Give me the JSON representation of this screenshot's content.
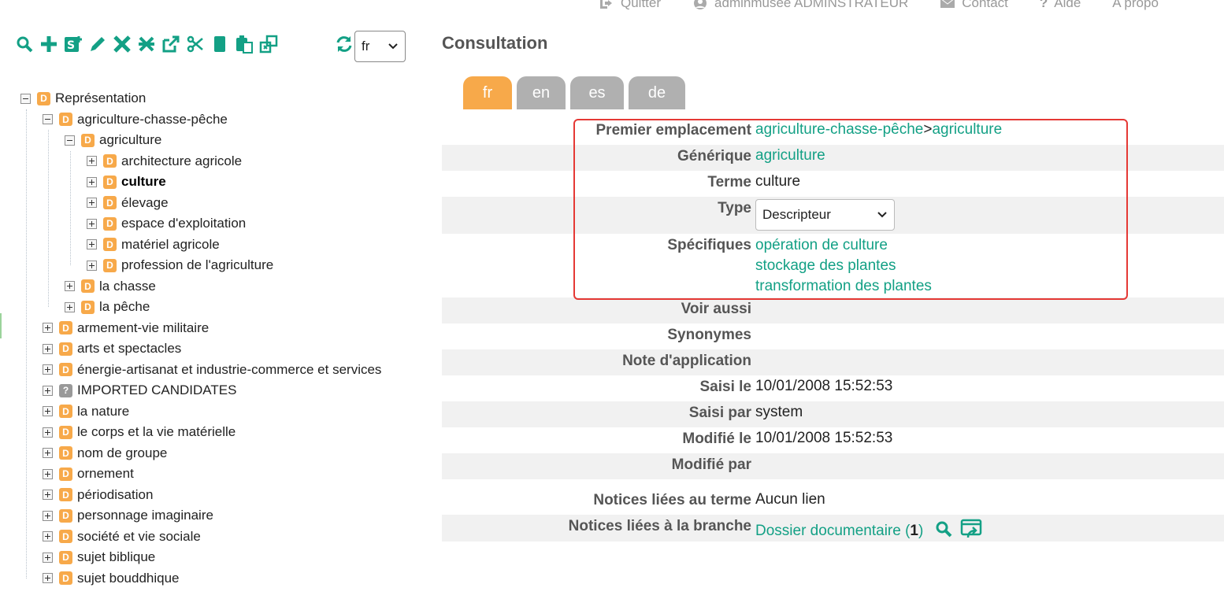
{
  "topnav": {
    "quit": "Quitter",
    "user": "adminmusee ADMINSTRATEUR",
    "contact": "Contact",
    "help": "Aide",
    "about": "A propo"
  },
  "toolbar": {
    "icons": [
      "search-icon",
      "add-icon",
      "add-sibling-icon",
      "edit-icon",
      "delete-icon",
      "move-icon",
      "external-link-icon",
      "cut-icon",
      "copy-icon",
      "paste-icon",
      "fusion-icon"
    ],
    "lang_value": "fr"
  },
  "tree": [
    {
      "label": "Représentation",
      "level": 0,
      "toggle": "minus",
      "badge": "D"
    },
    {
      "label": "agriculture-chasse-pêche",
      "level": 1,
      "toggle": "minus",
      "badge": "D"
    },
    {
      "label": "agriculture",
      "level": 2,
      "toggle": "minus",
      "badge": "D"
    },
    {
      "label": "architecture agricole",
      "level": 3,
      "toggle": "plus",
      "badge": "D"
    },
    {
      "label": "culture",
      "level": 3,
      "toggle": "plus",
      "badge": "D",
      "selected": true
    },
    {
      "label": "élevage",
      "level": 3,
      "toggle": "plus",
      "badge": "D"
    },
    {
      "label": "espace d'exploitation",
      "level": 3,
      "toggle": "plus",
      "badge": "D"
    },
    {
      "label": "matériel agricole",
      "level": 3,
      "toggle": "plus",
      "badge": "D"
    },
    {
      "label": "profession de l'agriculture",
      "level": 3,
      "toggle": "plus",
      "badge": "D"
    },
    {
      "label": "la chasse",
      "level": 2,
      "toggle": "plus",
      "badge": "D"
    },
    {
      "label": "la pêche",
      "level": 2,
      "toggle": "plus",
      "badge": "D"
    },
    {
      "label": "armement-vie militaire",
      "level": 1,
      "toggle": "plus",
      "badge": "D"
    },
    {
      "label": "arts et spectacles",
      "level": 1,
      "toggle": "plus",
      "badge": "D"
    },
    {
      "label": "énergie-artisanat et industrie-commerce et services",
      "level": 1,
      "toggle": "plus",
      "badge": "D"
    },
    {
      "label": "IMPORTED CANDIDATES",
      "level": 1,
      "toggle": "plus",
      "badge": "?"
    },
    {
      "label": "la nature",
      "level": 1,
      "toggle": "plus",
      "badge": "D"
    },
    {
      "label": "le corps et la vie matérielle",
      "level": 1,
      "toggle": "plus",
      "badge": "D"
    },
    {
      "label": "nom de groupe",
      "level": 1,
      "toggle": "plus",
      "badge": "D"
    },
    {
      "label": "ornement",
      "level": 1,
      "toggle": "plus",
      "badge": "D"
    },
    {
      "label": "périodisation",
      "level": 1,
      "toggle": "plus",
      "badge": "D"
    },
    {
      "label": "personnage imaginaire",
      "level": 1,
      "toggle": "plus",
      "badge": "D"
    },
    {
      "label": "société et vie sociale",
      "level": 1,
      "toggle": "plus",
      "badge": "D"
    },
    {
      "label": "sujet biblique",
      "level": 1,
      "toggle": "plus",
      "badge": "D"
    },
    {
      "label": "sujet bouddhique",
      "level": 1,
      "toggle": "plus",
      "badge": "D"
    }
  ],
  "consultation": {
    "title": "Consultation",
    "tabs": [
      "fr",
      "en",
      "es",
      "de"
    ],
    "active_tab": "fr",
    "premier_label": "Premier emplacement",
    "premier_parent": "agriculture-chasse-pêche",
    "premier_sep": ">",
    "premier_child": "agriculture",
    "generique_label": "Générique",
    "generique_value": "agriculture",
    "terme_label": "Terme",
    "terme_value": "culture",
    "type_label": "Type",
    "type_value": "Descripteur",
    "specifiques_label": "Spécifiques",
    "specifiques": [
      "opération de culture",
      "stockage des plantes",
      "transformation des plantes"
    ],
    "voir_label": "Voir aussi",
    "synonymes_label": "Synonymes",
    "note_label": "Note d'application",
    "saisi_le_label": "Saisi le",
    "saisi_le_value": "10/01/2008 15:52:53",
    "saisi_par_label": "Saisi par",
    "saisi_par_value": "system",
    "modifie_le_label": "Modifié le",
    "modifie_le_value": "10/01/2008 15:52:53",
    "modifie_par_label": "Modifié par",
    "notices_terme_label": "Notices liées au terme",
    "notices_terme_value": "Aucun lien",
    "notices_branche_label": "Notices liées à la branche",
    "notices_branche_link": "Dossier documentaire (",
    "notices_branche_count": "1",
    "notices_branche_close": ")"
  },
  "colors": {
    "accent": "#13a085",
    "tab_active": "#f7a94a",
    "tab_inactive": "#b0b0b0",
    "badge": "#f7a94a",
    "highlight_box": "#e53935"
  }
}
